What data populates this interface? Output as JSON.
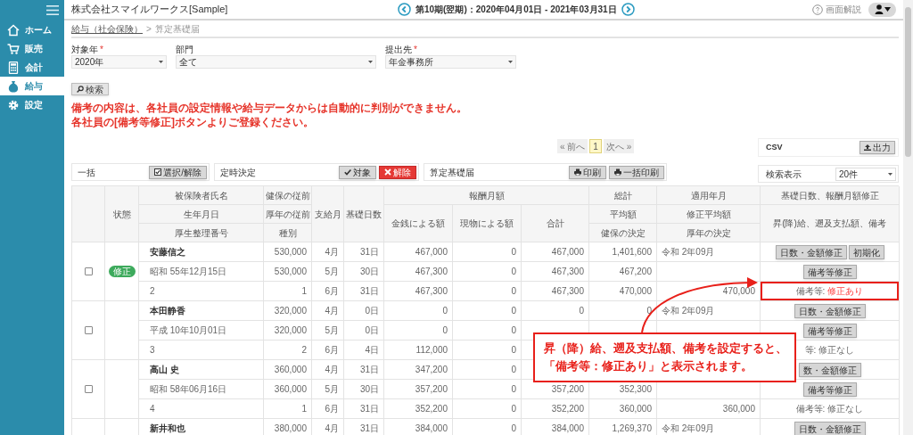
{
  "header": {
    "company": "株式会社スマイルワークス[Sample]",
    "period": "第10期(翌期)：2020年04月01日 - 2021年03月31日",
    "help": "画面解説"
  },
  "sidebar": [
    {
      "label": "ホーム",
      "selected": false
    },
    {
      "label": "販売",
      "selected": false
    },
    {
      "label": "会計",
      "selected": false
    },
    {
      "label": "給与",
      "selected": true
    },
    {
      "label": "設定",
      "selected": false
    }
  ],
  "breadcrumb": {
    "link": "給与（社会保険）",
    "separator": ">",
    "current": "算定基礎届"
  },
  "filters": [
    {
      "label": "対象年",
      "required_mark": "*",
      "value": "2020年"
    },
    {
      "label": "部門",
      "value": "全て"
    },
    {
      "label": "提出先",
      "required_mark": "*",
      "value": "年金事務所"
    }
  ],
  "search_button": "検索",
  "notice": [
    "備考の内容は、各社員の設定情報や給与データからは自動的に判別ができません。",
    "各社員の[備考等修正]ボタンよりご登録ください。"
  ],
  "pagination": [
    {
      "label": "« 前へ",
      "selected": false
    },
    {
      "label": "1",
      "selected": true
    },
    {
      "label": "次へ »",
      "selected": false
    }
  ],
  "csv": {
    "label": "CSV",
    "button": "出力"
  },
  "toolbar": [
    {
      "label": "一括",
      "buttons": [
        {
          "kind": "select",
          "label": "選択/解除"
        }
      ]
    },
    {
      "label": "定時決定",
      "buttons": [
        {
          "kind": "check",
          "label": "対象"
        },
        {
          "kind": "danger",
          "label": "解除"
        }
      ]
    },
    {
      "label": "算定基礎届",
      "buttons": [
        {
          "kind": "print",
          "label": "印刷"
        },
        {
          "kind": "print",
          "label": "一括印刷"
        }
      ]
    }
  ],
  "per_page": {
    "label": "検索表示",
    "value": "20件"
  },
  "table": {
    "header": {
      "status": "状態",
      "person": [
        "被保険者氏名",
        "生年月日",
        "厚生整理番号"
      ],
      "prior": [
        "健保の従前",
        "厚年の従前",
        "種別"
      ],
      "month": "支給月",
      "days": "基礎日数",
      "pay": "報酬月額",
      "cash": "金銭による額",
      "in_kind": "現物による額",
      "total": "合計",
      "grand": [
        "総計",
        "平均額",
        "健保の決定"
      ],
      "applied": [
        "適用年月",
        "修正平均額",
        "厚年の決定"
      ],
      "fix": [
        "基礎日数、報酬月額修正",
        "昇(降)給、遡及支払額、備考"
      ]
    },
    "employees": [
      {
        "checked": false,
        "status_badge": "修正",
        "rows": [
          {
            "person": "安藤信之",
            "prior": "530,000",
            "month": "4月",
            "days": "31日",
            "cash": "467,000",
            "in_kind": "0",
            "total": "467,000",
            "grand": "1,401,600",
            "applied": "令和 2年09月",
            "actions": [
              {
                "kind": "button",
                "label": "日数・金額修正"
              },
              {
                "kind": "button",
                "label": "初期化"
              }
            ]
          },
          {
            "person": "昭和 55年12月15日",
            "prior": "530,000",
            "month": "5月",
            "days": "30日",
            "cash": "467,300",
            "in_kind": "0",
            "total": "467,300",
            "grand": "467,200",
            "actions": [
              {
                "kind": "button",
                "label": "備考等修正"
              }
            ]
          },
          {
            "person": "2",
            "prior": "1",
            "month": "6月",
            "days": "31日",
            "cash": "467,300",
            "in_kind": "0",
            "total": "467,300",
            "grand": "470,000",
            "applied": "470,000",
            "highlighted": true,
            "actions": [
              {
                "kind": "note",
                "label": "備考等:",
                "value": "修正あり",
                "modified": true
              }
            ]
          }
        ]
      },
      {
        "checked": false,
        "rows": [
          {
            "person": "本田静香",
            "prior": "320,000",
            "month": "4月",
            "days": "0日",
            "cash": "0",
            "in_kind": "0",
            "total": "0",
            "grand": "0",
            "applied": "令和 2年09月",
            "actions": [
              {
                "kind": "button",
                "label": "日数・金額修正"
              }
            ]
          },
          {
            "person": "平成 10年10月01日",
            "prior": "320,000",
            "month": "5月",
            "days": "0日",
            "cash": "0",
            "in_kind": "0",
            "actions": [
              {
                "kind": "button",
                "label": "備考等修正"
              }
            ]
          },
          {
            "person": "3",
            "prior": "2",
            "month": "6月",
            "days": "4日",
            "cash": "112,000",
            "in_kind": "0",
            "actions": [
              {
                "kind": "note",
                "label": "等:",
                "value": "修正なし",
                "modified": false
              }
            ]
          }
        ]
      },
      {
        "checked": false,
        "rows": [
          {
            "person": "高山 史",
            "prior": "360,000",
            "month": "4月",
            "days": "31日",
            "cash": "347,200",
            "in_kind": "0",
            "actions": [
              {
                "kind": "button",
                "label": "数・金額修正"
              }
            ]
          },
          {
            "person": "昭和 58年06月16日",
            "prior": "360,000",
            "month": "5月",
            "days": "30日",
            "cash": "357,200",
            "in_kind": "0",
            "total": "357,200",
            "grand": "352,300",
            "actions": [
              {
                "kind": "button",
                "label": "備考等修正"
              }
            ]
          },
          {
            "person": "4",
            "prior": "1",
            "month": "6月",
            "days": "31日",
            "cash": "352,200",
            "in_kind": "0",
            "total": "352,200",
            "grand": "360,000",
            "applied": "360,000",
            "actions": [
              {
                "kind": "note",
                "label": "備考等:",
                "value": "修正なし",
                "modified": false
              }
            ]
          }
        ]
      },
      {
        "rows": [
          {
            "person": "新井和也",
            "prior": "380,000",
            "month": "4月",
            "days": "31日",
            "cash": "384,000",
            "in_kind": "0",
            "total": "384,000",
            "grand": "1,269,370",
            "applied": "令和 2年09月",
            "actions": [
              {
                "kind": "button",
                "label": "日数・金額修正"
              }
            ]
          }
        ]
      }
    ]
  },
  "callout": [
    "昇（降）給、遡及支払額、備考を設定すると、",
    "「備考等：修正あり」と表示されます。"
  ]
}
